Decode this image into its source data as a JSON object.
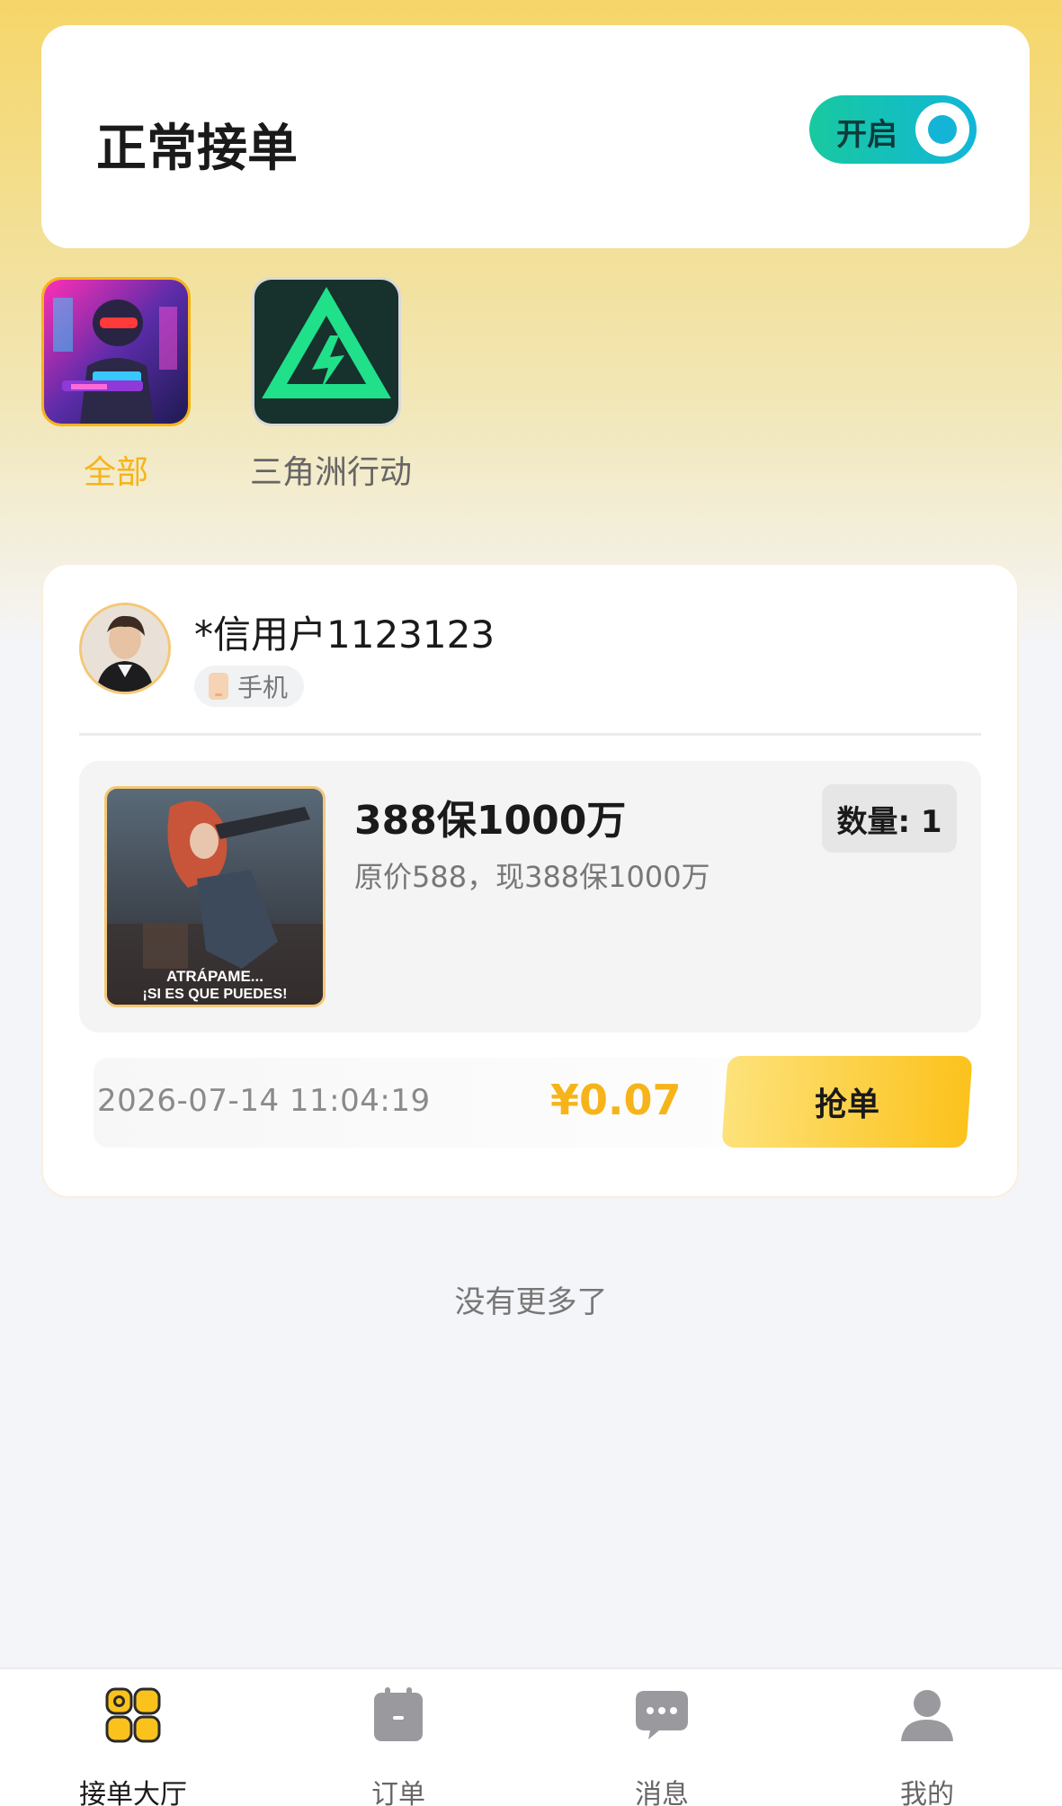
{
  "accept": {
    "title": "正常接单",
    "toggle_label": "开启",
    "toggle_on": true
  },
  "categories": [
    {
      "label": "全部",
      "icon": "soldier-game-icon",
      "active": true
    },
    {
      "label": "三角洲行动",
      "icon": "delta-force-logo-icon",
      "active": false
    }
  ],
  "order": {
    "username": "*信用户1123123",
    "device": "手机",
    "product_title": "388保1000万",
    "product_desc": "原价588，现388保1000万",
    "quantity": "数量: 1",
    "image_text_line1": "ATRÁPAME...",
    "image_text_line2": "¡SI ES QUE PUEDES!",
    "time": "2026-07-14 11:04:19",
    "price": "¥0.07",
    "grab_label": "抢单"
  },
  "footer": {
    "no_more": "没有更多了"
  },
  "nav": [
    {
      "label": "接单大厅",
      "icon": "hall-grid-icon",
      "active": true
    },
    {
      "label": "订单",
      "icon": "order-calendar-icon",
      "active": false
    },
    {
      "label": "消息",
      "icon": "message-bubble-icon",
      "active": false
    },
    {
      "label": "我的",
      "icon": "user-profile-icon",
      "active": false
    }
  ],
  "colors": {
    "accent": "#f6b41a",
    "toggle": "#14b4d6",
    "grab_button": "#fcc21c"
  }
}
